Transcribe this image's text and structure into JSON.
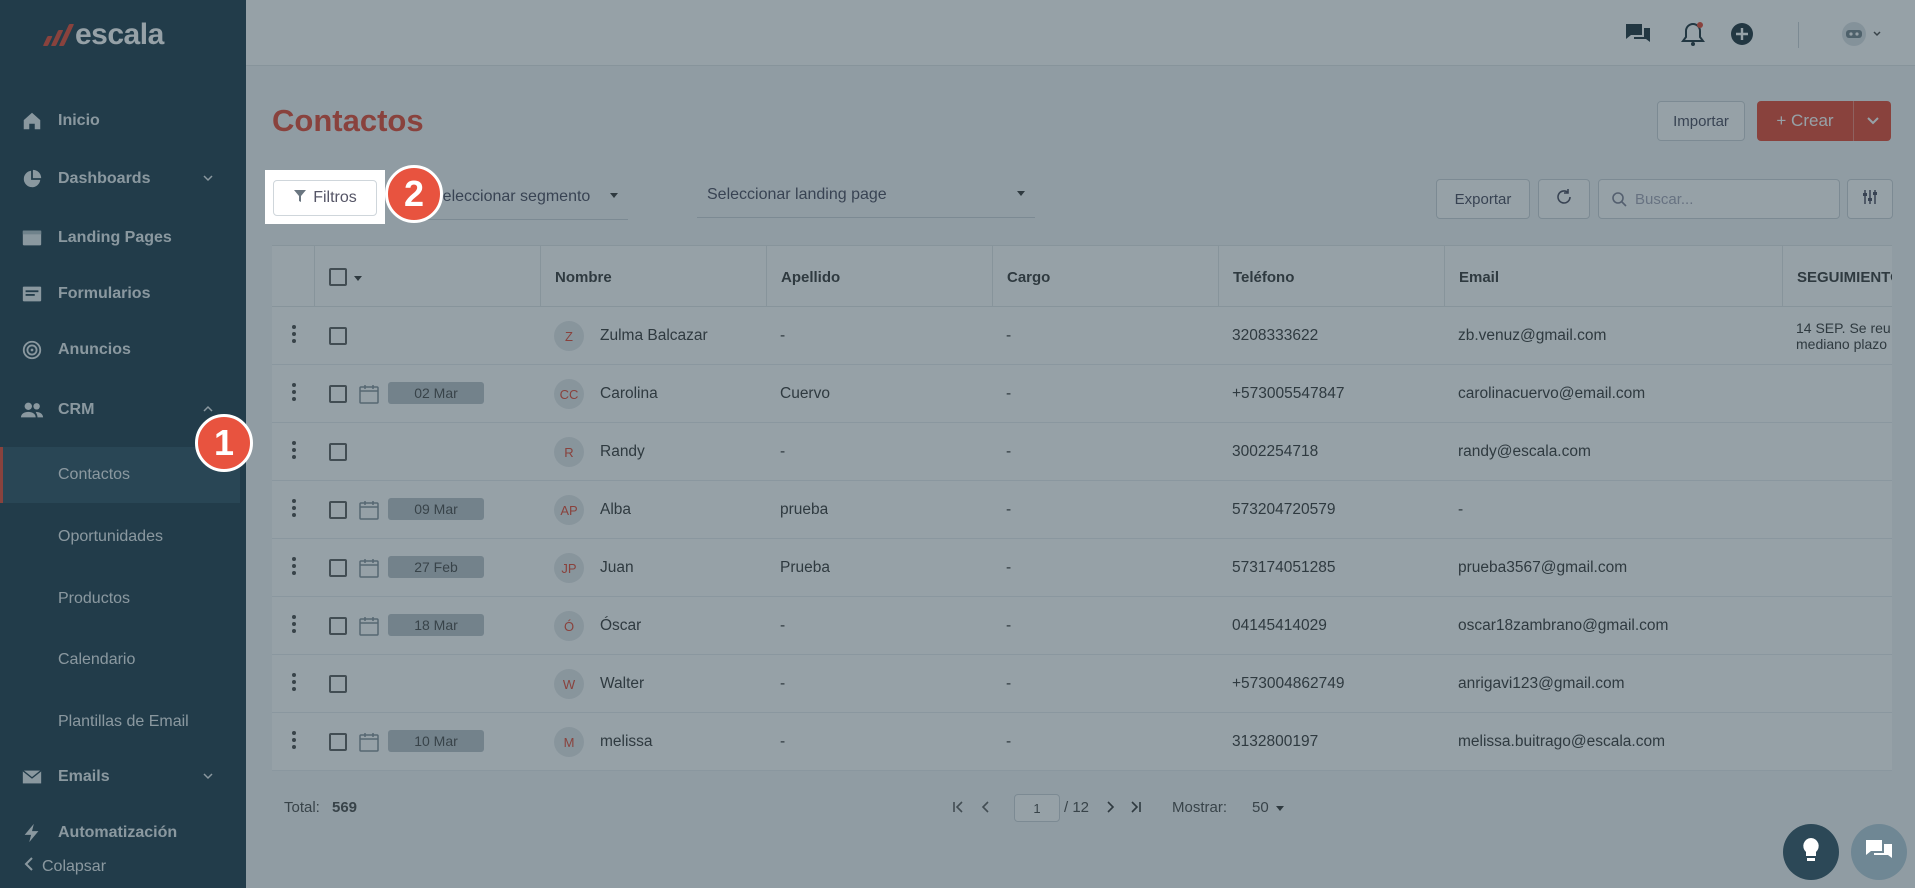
{
  "brand": {
    "name": "escala"
  },
  "sidebar": {
    "items": [
      {
        "label": "Inicio",
        "icon": "home-icon"
      },
      {
        "label": "Dashboards",
        "icon": "pie-chart-icon"
      },
      {
        "label": "Landing Pages",
        "icon": "browser-icon"
      },
      {
        "label": "Formularios",
        "icon": "form-icon"
      },
      {
        "label": "Anuncios",
        "icon": "target-icon"
      },
      {
        "label": "CRM",
        "icon": "users-icon"
      }
    ],
    "crm_subitems": [
      "Contactos",
      "Oportunidades",
      "Productos",
      "Calendario",
      "Plantillas de Email"
    ],
    "bottom_items": [
      {
        "label": "Emails",
        "icon": "mail-icon"
      },
      {
        "label": "Automatización",
        "icon": "bolt-icon"
      }
    ],
    "collapse_label": "Colapsar"
  },
  "page": {
    "title": "Contactos",
    "import_label": "Importar",
    "create_label": "+ Crear",
    "filters_label": "Filtros",
    "segment_placeholder": "Seleccionar segmento",
    "landing_placeholder": "Seleccionar landing page",
    "export_label": "Exportar",
    "search_placeholder": "Buscar..."
  },
  "table": {
    "columns": [
      "Nombre",
      "Apellido",
      "Cargo",
      "Teléfono",
      "Email",
      "SEGUIMIENTO"
    ],
    "rows": [
      {
        "initials": "Z",
        "date": "",
        "nombre": "Zulma Balcazar",
        "apellido": "-",
        "cargo": "-",
        "telefono": "3208333622",
        "email": "zb.venuz@gmail.com",
        "seguimiento": "14 SEP. Se reu mediano plazo"
      },
      {
        "initials": "CC",
        "date": "02 Mar",
        "nombre": "Carolina",
        "apellido": "Cuervo",
        "cargo": "-",
        "telefono": "+573005547847",
        "email": "carolinacuervo@email.com",
        "seguimiento": ""
      },
      {
        "initials": "R",
        "date": "",
        "nombre": "Randy",
        "apellido": "-",
        "cargo": "-",
        "telefono": "3002254718",
        "email": "randy@escala.com",
        "seguimiento": ""
      },
      {
        "initials": "AP",
        "date": "09 Mar",
        "nombre": "Alba",
        "apellido": "prueba",
        "cargo": "-",
        "telefono": "573204720579",
        "email": "-",
        "seguimiento": ""
      },
      {
        "initials": "JP",
        "date": "27 Feb",
        "nombre": "Juan",
        "apellido": "Prueba",
        "cargo": "-",
        "telefono": "573174051285",
        "email": "prueba3567@gmail.com",
        "seguimiento": ""
      },
      {
        "initials": "Ó",
        "date": "18 Mar",
        "nombre": "Óscar",
        "apellido": "-",
        "cargo": "-",
        "telefono": "04145414029",
        "email": "oscar18zambrano@gmail.com",
        "seguimiento": ""
      },
      {
        "initials": "W",
        "date": "",
        "nombre": "Walter",
        "apellido": "-",
        "cargo": "-",
        "telefono": "+573004862749",
        "email": "anrigavi123@gmail.com",
        "seguimiento": ""
      },
      {
        "initials": "M",
        "date": "10 Mar",
        "nombre": "melissa",
        "apellido": "-",
        "cargo": "-",
        "telefono": "3132800197",
        "email": "melissa.buitrago@escala.com",
        "seguimiento": ""
      }
    ]
  },
  "footer": {
    "total_label": "Total:",
    "total_value": "569",
    "page_current": "1",
    "page_total": "/ 12",
    "show_label": "Mostrar:",
    "show_value": "50"
  },
  "tutorial": {
    "step1": "1",
    "step2": "2"
  },
  "colors": {
    "accent": "#e8533f",
    "sidebar": "#2c4857",
    "overlay": "rgba(22,46,60,0.45)"
  }
}
